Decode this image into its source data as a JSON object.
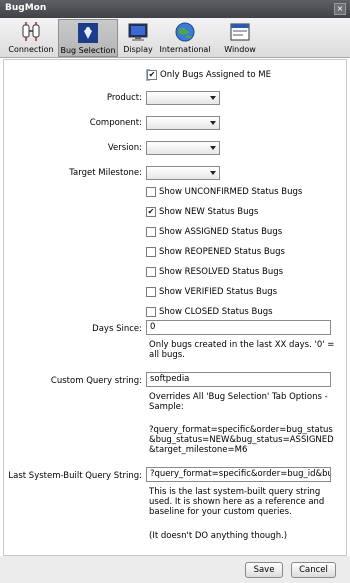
{
  "window": {
    "title": "BugMon",
    "close_glyph": "×"
  },
  "tabs": [
    {
      "label": "Connection",
      "icon": "connection-plug-icon"
    },
    {
      "label": "Bug Selection",
      "icon": "bug-selection-icon",
      "active": true
    },
    {
      "label": "Display",
      "icon": "monitor-icon"
    },
    {
      "label": "International",
      "icon": "globe-icon"
    },
    {
      "label": "Window",
      "icon": "window-icon"
    }
  ],
  "only_assigned": {
    "label": "Only Bugs Assigned to ME",
    "checked": true
  },
  "selects": {
    "product_label": "Product:",
    "component_label": "Component:",
    "version_label": "Version:",
    "milestone_label": "Target Milestone:"
  },
  "status_filters": [
    {
      "label": "Show UNCONFIRMED Status Bugs",
      "checked": false
    },
    {
      "label": "Show NEW Status Bugs",
      "checked": true
    },
    {
      "label": "Show ASSIGNED Status Bugs",
      "checked": false
    },
    {
      "label": "Show REOPENED Status Bugs",
      "checked": false
    },
    {
      "label": "Show RESOLVED Status Bugs",
      "checked": false
    },
    {
      "label": "Show VERIFIED Status Bugs",
      "checked": false
    },
    {
      "label": "Show CLOSED Status Bugs",
      "checked": false
    }
  ],
  "days_since": {
    "label": "Days Since:",
    "value": "0",
    "help": "Only bugs created in the last XX days. '0' = all bugs."
  },
  "custom_query": {
    "label": "Custom Query string:",
    "value": "softpedia",
    "help1": "Overrides All 'Bug Selection' Tab Options - Sample:",
    "help2": "?query_format=specific&order=bug_status&bug_status=NEW&bug_status=ASSIGNED&target_milestone=M6"
  },
  "last_query": {
    "label": "Last System-Built Query String:",
    "value": "?query_format=specific&order=bug_id&bug_",
    "help1": "This is the last system-built query string used. It is shown here as a reference and baseline for your custom queries.",
    "help2": "(It doesn't DO anything though.)"
  },
  "buttons": {
    "save": "Save",
    "cancel": "Cancel"
  },
  "colors": {
    "titlebar": "#4a4d51",
    "accent": "#2a5db0"
  }
}
